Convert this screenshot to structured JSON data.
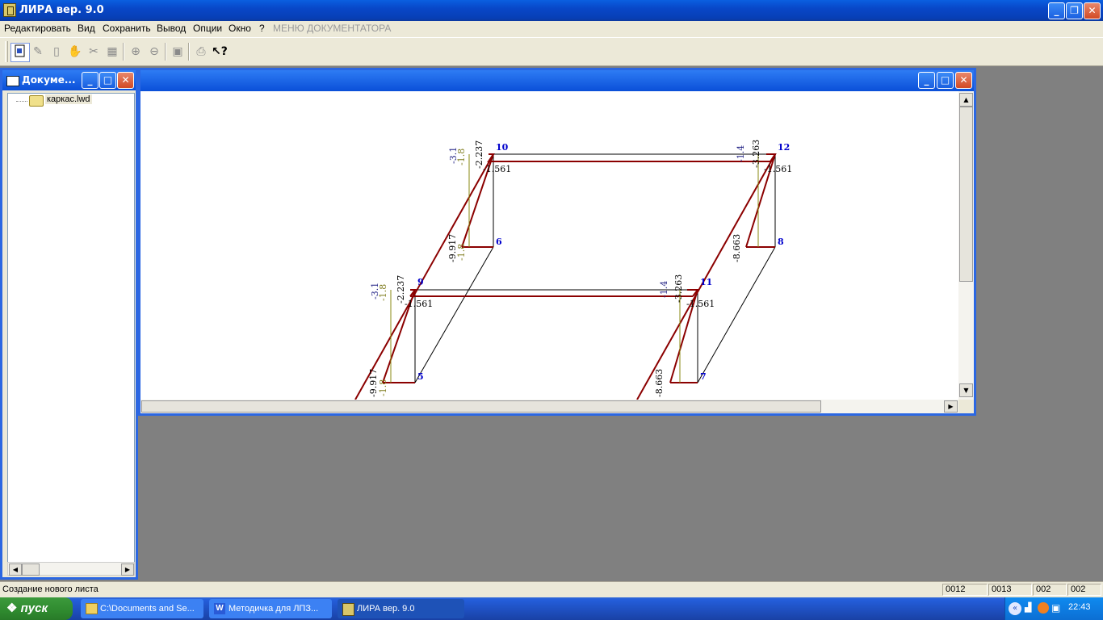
{
  "app": {
    "title": "ЛИРА  вер. 9.0"
  },
  "menu": [
    "Редактировать",
    "Вид",
    "Сохранить",
    "Вывод",
    "Опции",
    "Окно",
    "?",
    "МЕНЮ ДОКУМЕНТАТОРА"
  ],
  "toolbar": {
    "icons": [
      "document-icon",
      "abc-pen-icon",
      "page-icon",
      "hand-icon",
      "scissors-icon",
      "hatch-icon",
      "zoom-in-icon",
      "zoom-out-icon",
      "save-icon",
      "print-icon",
      "help-cursor-icon"
    ]
  },
  "doc_panel": {
    "title": "Докуме...",
    "file": "каркас.lwd"
  },
  "frame": {
    "nodes": {
      "n5": "5",
      "n6": "6",
      "n7": "7",
      "n8": "8",
      "n9": "9",
      "n10": "10",
      "n11": "11",
      "n12": "12"
    },
    "labels": {
      "v_1561": "-1.561",
      "v_2237": "-2.237",
      "v_3_1": "-3.1",
      "v_1_8": "-1.8",
      "v_9917": "-9.917",
      "v_8663": "-8.663",
      "v_3263": "-3.263",
      "v_1_4": "-1.4"
    }
  },
  "status": {
    "text": "Создание нового листа",
    "panes": [
      "0012",
      "0013",
      "002",
      "002"
    ]
  },
  "taskbar": {
    "start": "пуск",
    "tasks": [
      "C:\\Documents and Se...",
      "Методичка для ЛПЗ...",
      "ЛИРА  вер. 9.0"
    ],
    "clock": "22:43"
  }
}
